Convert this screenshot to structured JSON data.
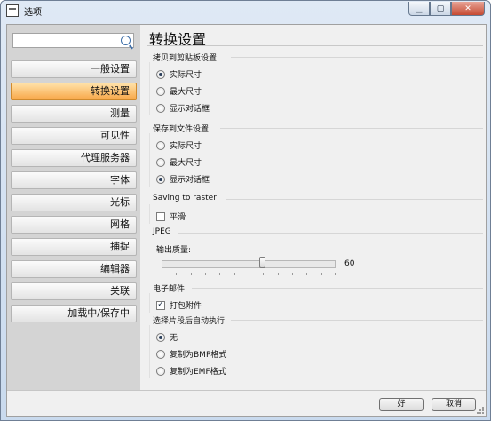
{
  "window": {
    "title": "选项"
  },
  "sidebar": {
    "search_value": "",
    "items": [
      {
        "label": "一般设置"
      },
      {
        "label": "转换设置"
      },
      {
        "label": "测量"
      },
      {
        "label": "可见性"
      },
      {
        "label": "代理服务器"
      },
      {
        "label": "字体"
      },
      {
        "label": "光标"
      },
      {
        "label": "网格"
      },
      {
        "label": "捕捉"
      },
      {
        "label": "编辑器"
      },
      {
        "label": "关联"
      },
      {
        "label": "加载中/保存中"
      }
    ],
    "active_index": 1
  },
  "content": {
    "title": "转换设置",
    "clipboard": {
      "label": "拷贝到剪贴板设置",
      "options": [
        "实际尺寸",
        "最大尺寸",
        "显示对话框"
      ],
      "selected": 0
    },
    "file": {
      "label": "保存到文件设置",
      "options": [
        "实际尺寸",
        "最大尺寸",
        "显示对话框"
      ],
      "selected": 2
    },
    "raster": {
      "label": "Saving to raster",
      "smooth_label": "平滑",
      "smooth_checked": false
    },
    "jpeg": {
      "label": "JPEG",
      "quality_label": "输出质量:",
      "quality_value": "60",
      "quality_fraction": 0.6
    },
    "email": {
      "label": "电子邮件",
      "attach_label": "打包附件",
      "attach_checked": true
    },
    "after_select": {
      "label": "选择片段后自动执行:",
      "options": [
        "无",
        "复制为BMP格式",
        "复制为EMF格式"
      ],
      "selected": 0
    }
  },
  "footer": {
    "ok_label": "好",
    "cancel_label": "取消"
  },
  "colors": {
    "active_item": "#f8a84a",
    "close_button": "#c64a32"
  }
}
